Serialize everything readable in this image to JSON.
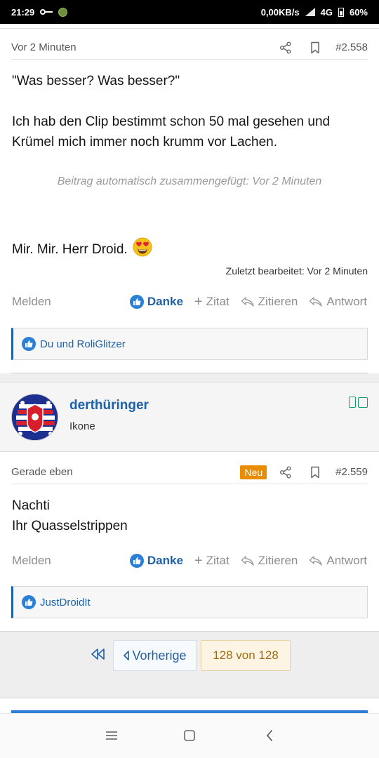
{
  "status_bar": {
    "time": "21:29",
    "network_speed": "0,00KB/s",
    "network_type": "4G",
    "battery": "60%"
  },
  "post1": {
    "time": "Vor 2 Minuten",
    "number": "#2.558",
    "line1": "\"Was besser? Was besser?\"",
    "paragraph2": "Ich hab den Clip bestimmt schon 50 mal gesehen und Krümel mich immer noch krumm vor Lachen.",
    "merge_note": "Beitrag automatisch zusammengefügt: Vor 2 Minuten",
    "line3": "Mir. Mir. Herr Droid.",
    "emoji": "heart-eyes-emoji",
    "edited": "Zuletzt bearbeitet: Vor 2 Minuten",
    "reactions": "Du und RoliGlitzer"
  },
  "actions": {
    "report": "Melden",
    "like": "Danke",
    "quote": "Zitat",
    "cite": "Zitieren",
    "reply": "Antwort"
  },
  "user": {
    "name": "derthüringer",
    "title": "Ikone"
  },
  "post2": {
    "time": "Gerade eben",
    "badge": "Neu",
    "number": "#2.559",
    "line1": "Nachti",
    "line2": "Ihr Quasselstrippen",
    "reactions": "JustDroidIt"
  },
  "pagination": {
    "prev_label": "Vorherige",
    "current": "128 von 128"
  },
  "colors": {
    "link": "#1f61a8",
    "like": "#2b7fd4",
    "badge_new": "#e88c00",
    "page_current_bg": "#fdf4e3"
  }
}
